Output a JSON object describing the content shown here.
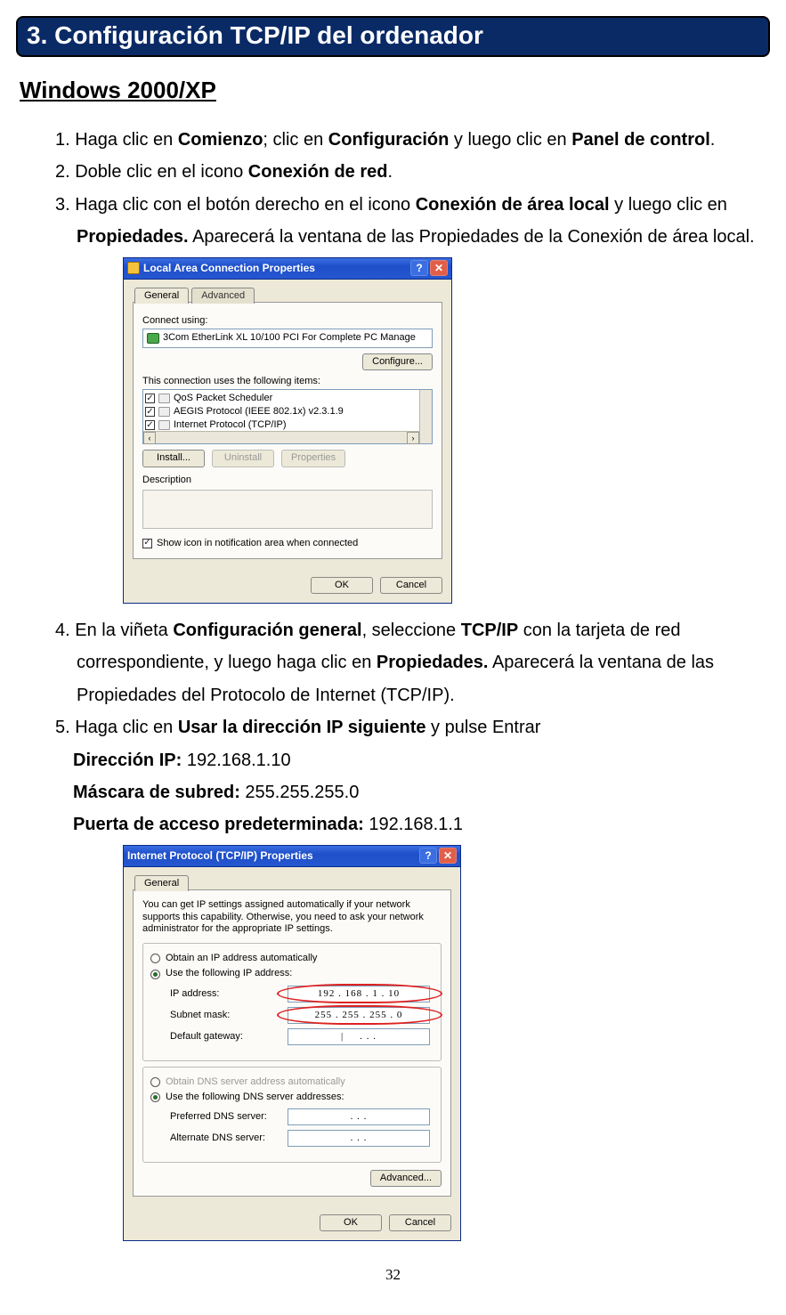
{
  "banner": {
    "title": "3. Configuración TCP/IP del ordenador"
  },
  "heading": "Windows 2000/XP",
  "steps": {
    "s1": {
      "pre": "1. Haga clic en ",
      "b1": "Comienzo",
      "mid1": "; clic en ",
      "b2": "Configuración",
      "mid2": " y luego clic en ",
      "b3": "Panel de control",
      "post": "."
    },
    "s2": {
      "pre": "2. Doble clic en el icono ",
      "b1": "Conexión de red",
      "post": "."
    },
    "s3": {
      "pre": "3. Haga clic con el botón derecho en el icono ",
      "b1": "Conexión de área local",
      "mid1": " y luego clic en ",
      "b2": "Propiedades.",
      "post": " Aparecerá la ventana de las Propiedades de la Conexión de área local."
    },
    "s4": {
      "pre": "4. En la viñeta ",
      "b1": "Configuración general",
      "mid1": ", seleccione ",
      "b2": "TCP/IP",
      "mid2": " con la tarjeta de red correspondiente, y luego haga clic en ",
      "b3": "Propiedades.",
      "post": " Aparecerá la ventana de las Propiedades del Protocolo de Internet (TCP/IP)."
    },
    "s5": {
      "pre": "5. Haga clic en ",
      "b1": "Usar la dirección IP siguiente",
      "post": " y pulse Entrar"
    },
    "ip": {
      "lbl": "Dirección IP:",
      "val": " 192.168.1.10"
    },
    "mask": {
      "lbl": "Máscara de subred:",
      "val": " 255.255.255.0"
    },
    "gw": {
      "lbl": "Puerta de acceso predeterminada:",
      "val": " 192.168.1.1"
    }
  },
  "dlg1": {
    "title": "Local Area Connection Properties",
    "tab_general": "General",
    "tab_advanced": "Advanced",
    "connect_using": "Connect using:",
    "adapter": "3Com EtherLink XL 10/100 PCI For Complete PC Manage",
    "configure": "Configure...",
    "uses_items": "This connection uses the following items:",
    "items": [
      "QoS Packet Scheduler",
      "AEGIS Protocol (IEEE 802.1x) v2.3.1.9",
      "Internet Protocol (TCP/IP)"
    ],
    "install": "Install...",
    "uninstall": "Uninstall",
    "properties": "Properties",
    "description": "Description",
    "show_icon": "Show icon in notification area when connected",
    "ok": "OK",
    "cancel": "Cancel"
  },
  "dlg2": {
    "title": "Internet Protocol (TCP/IP) Properties",
    "tab_general": "General",
    "blurb": "You can get IP settings assigned automatically if your network supports this capability. Otherwise, you need to ask your network administrator for the appropriate IP settings.",
    "r_obtain_ip": "Obtain an IP address automatically",
    "r_use_ip": "Use the following IP address:",
    "ip_lbl": "IP address:",
    "ip_val": "192 . 168 .  1  .  10",
    "mask_lbl": "Subnet mask:",
    "mask_val": "255 . 255 . 255 .  0",
    "gw_lbl": "Default gateway:",
    "gw_val": ".       .       .",
    "r_obtain_dns": "Obtain DNS server address automatically",
    "r_use_dns": "Use the following DNS server addresses:",
    "pdns_lbl": "Preferred DNS server:",
    "pdns_val": ".       .       .",
    "adns_lbl": "Alternate DNS server:",
    "adns_val": ".       .       .",
    "advanced": "Advanced...",
    "ok": "OK",
    "cancel": "Cancel"
  },
  "page_number": "32"
}
